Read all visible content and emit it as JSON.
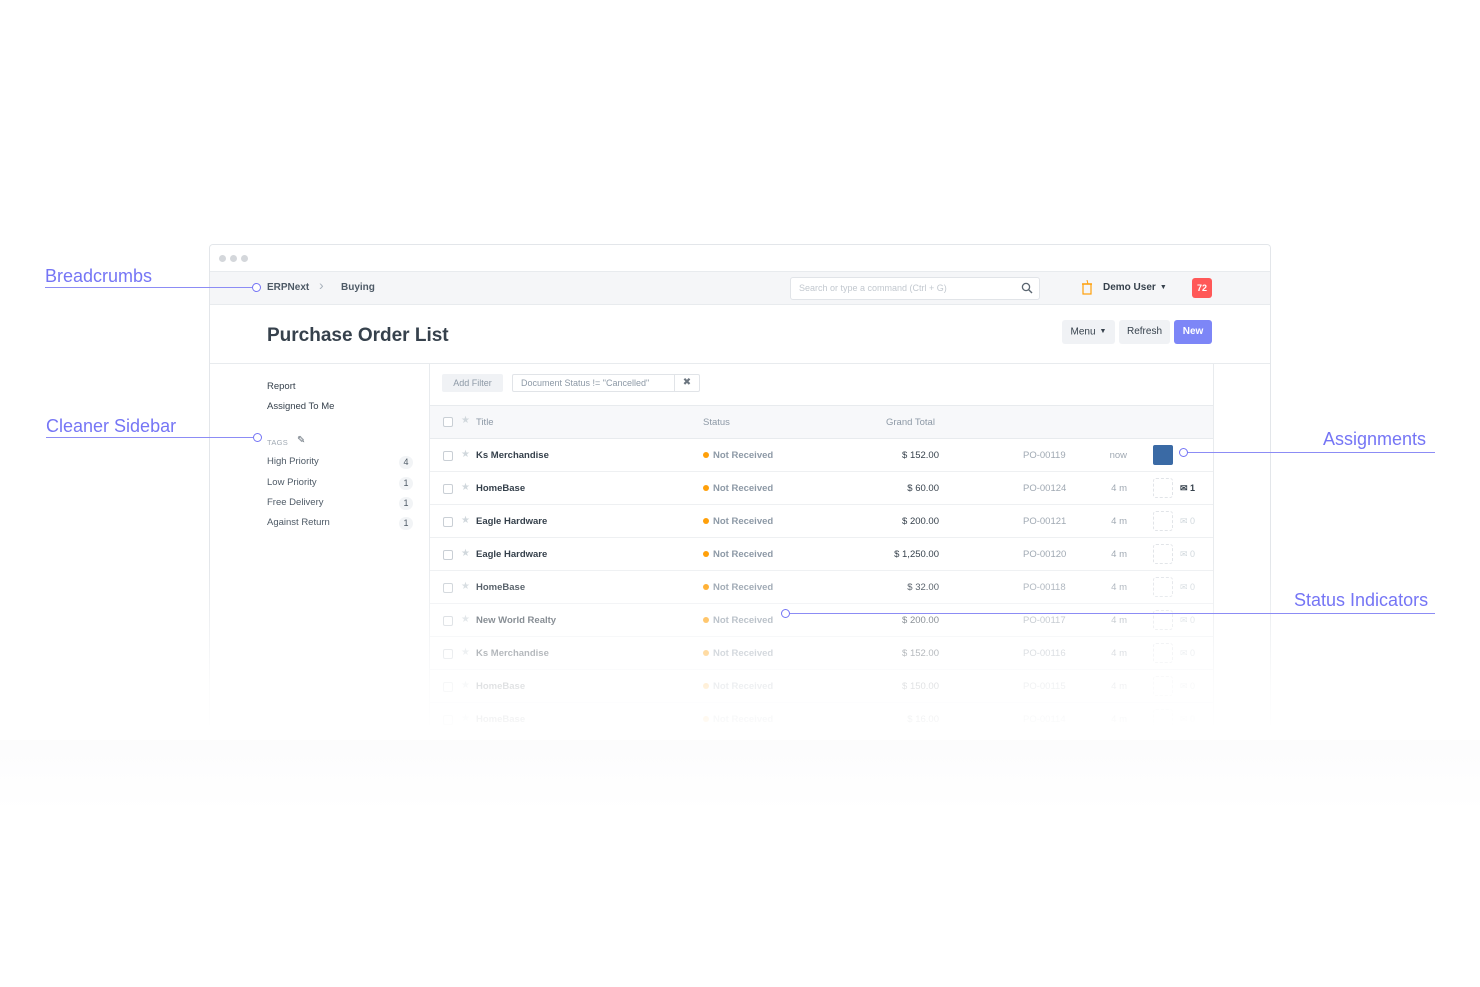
{
  "annotations": {
    "breadcrumbs": "Breadcrumbs",
    "sidebar": "Cleaner Sidebar",
    "assignments": "Assignments",
    "status": "Status Indicators"
  },
  "breadcrumb": [
    "ERPNext",
    "Buying"
  ],
  "search": {
    "placeholder": "Search or type a command (Ctrl + G)"
  },
  "user": {
    "name": "Demo User",
    "notifications": "72"
  },
  "page": {
    "title": "Purchase Order List"
  },
  "toolbar": {
    "menu": "Menu",
    "refresh": "Refresh",
    "new": "New"
  },
  "sidebar": {
    "items": [
      "Report",
      "Assigned To Me"
    ],
    "tags_heading": "TAGS",
    "tags": [
      {
        "label": "High Priority",
        "count": "4"
      },
      {
        "label": "Low Priority",
        "count": "1"
      },
      {
        "label": "Free Delivery",
        "count": "1"
      },
      {
        "label": "Against Return",
        "count": "1"
      }
    ]
  },
  "filters": {
    "add": "Add Filter",
    "chip": "Document Status != \"Cancelled\"",
    "remove": "✖"
  },
  "table": {
    "headers": {
      "title": "Title",
      "status": "Status",
      "total": "Grand Total"
    },
    "rows": [
      {
        "title": "Ks Merchandise",
        "status": "Not Received",
        "total": "$ 152.00",
        "po": "PO-00119",
        "time": "now",
        "comments": ""
      },
      {
        "title": "HomeBase",
        "status": "Not Received",
        "total": "$ 60.00",
        "po": "PO-00124",
        "time": "4 m",
        "comments": "1"
      },
      {
        "title": "Eagle Hardware",
        "status": "Not Received",
        "total": "$ 200.00",
        "po": "PO-00121",
        "time": "4 m",
        "comments": "0"
      },
      {
        "title": "Eagle Hardware",
        "status": "Not Received",
        "total": "$ 1,250.00",
        "po": "PO-00120",
        "time": "4 m",
        "comments": "0"
      },
      {
        "title": "HomeBase",
        "status": "Not Received",
        "total": "$ 32.00",
        "po": "PO-00118",
        "time": "4 m",
        "comments": "0"
      },
      {
        "title": "New World Realty",
        "status": "Not Received",
        "total": "$ 200.00",
        "po": "PO-00117",
        "time": "4 m",
        "comments": "0"
      },
      {
        "title": "Ks Merchandise",
        "status": "Not Received",
        "total": "$ 152.00",
        "po": "PO-00116",
        "time": "4 m",
        "comments": "0"
      },
      {
        "title": "HomeBase",
        "status": "Not Received",
        "total": "$ 150.00",
        "po": "PO-00115",
        "time": "4 m",
        "comments": "0"
      },
      {
        "title": "HomeBase",
        "status": "Not Received",
        "total": "$ 16.00",
        "po": "PO-00114",
        "time": "4 m",
        "comments": "0"
      }
    ]
  }
}
